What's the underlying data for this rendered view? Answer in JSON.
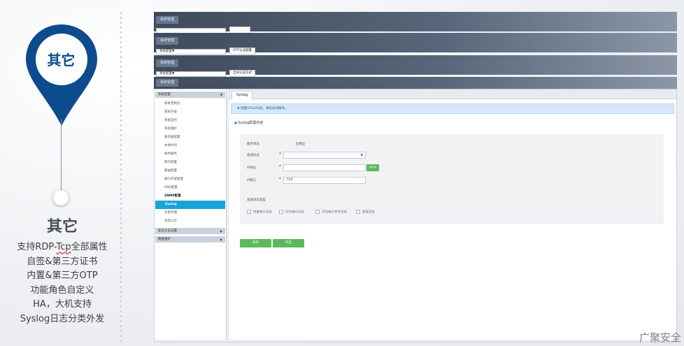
{
  "promo": {
    "pin_label": "其它",
    "title": "其它",
    "features": [
      "支持RDP-Tcp全部属性",
      "自签&第三方证书",
      "内置&第三方OTP",
      "功能角色自定义",
      "HA，大机支持",
      "Syslog日志分类外发"
    ],
    "colors": {
      "pin_blue": "#0d4c8c",
      "pin_inner": "#ffffff"
    }
  },
  "strips": [
    {
      "button": "系统管理",
      "combo": "",
      "chip": ""
    },
    {
      "button": "系统管理",
      "combo": "系统配置",
      "chip": "OTP认证配置"
    },
    {
      "button": "系统管理",
      "combo": "系统配置",
      "chip": "全局认证方式"
    },
    {
      "button": "系统管理",
      "combo": "",
      "chip": ""
    }
  ],
  "sidebar": {
    "group_top": "系统配置",
    "items": [
      "系统定制化",
      "系统升级",
      "系统监控",
      "系统维护",
      "服务器配置",
      "本地时间",
      "邮件服务",
      "网卡配置",
      "路由配置",
      "端口开放管理",
      "DNS配置",
      "SNMP配置",
      "Syslog",
      "外接存储",
      "消息公告"
    ],
    "bold_item": "SNMP配置",
    "active_item": "Syslog",
    "groups_bottom": [
      "安全认证设置",
      "数据维护"
    ]
  },
  "content": {
    "tab": "Syslog",
    "notice": "配置SYSLOG前，请先关闭服务。",
    "section_title": "Syslog配置内容",
    "form": {
      "status_label": "服务状态",
      "status_value": "已停止",
      "protocol_label": "发送协议",
      "ip_label": "IP地址",
      "ping_button": "ping",
      "port_label": "IP端口",
      "port_value": "514",
      "log_type_label": "发送日志类型",
      "log_types": [
        "内部审计日志",
        "行为审计日志",
        "行为审计命令日志",
        "登录日志"
      ]
    },
    "save_button": "保存",
    "start_button": "开启"
  },
  "watermark": "广聚安全"
}
